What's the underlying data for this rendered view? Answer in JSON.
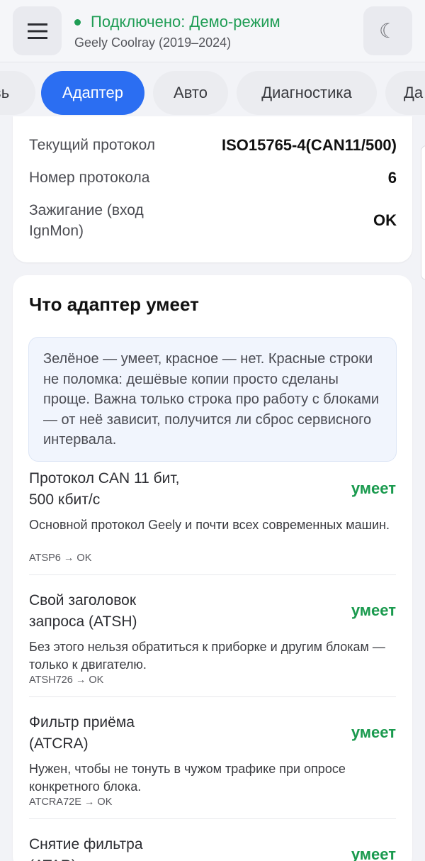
{
  "header": {
    "status": "Подключено: Демо-режим",
    "model": "Geely Coolray (2019–2024)",
    "menu_icon": "hamburger-icon",
    "theme_icon": "moon-icon",
    "theme_glyph": "☾"
  },
  "tabs": [
    "вь",
    "Адаптер",
    "Авто",
    "Диагностика",
    "Да"
  ],
  "protocol_info": {
    "rows": [
      {
        "label": "Текущий протокол",
        "value": "ISO15765-4(CAN11/500)"
      },
      {
        "label": "Номер протокола",
        "value": "6"
      },
      {
        "label": "Зажигание (вход IgnMon)",
        "value": "OK"
      }
    ]
  },
  "capabilities": {
    "title": "Что адаптер умеет",
    "note": "Зелёное — умеет, красное — нет. Красные строки не поломка: дешёвые копии просто сделаны проще. Важна только строка про работу с блоками — от неё зависит, получится ли сброс сервисного интервала.",
    "items": [
      {
        "name": "Протокол CAN 11 бит, 500 кбит/с",
        "status": "умеет",
        "description": "Основной протокол Geely и почти всех современных машин.",
        "command": "ATSP6 → OK"
      },
      {
        "name": "Свой заголовок запроса (ATSH)",
        "status": "умеет",
        "description": "Без этого нельзя обратиться к приборке и другим блокам — только к двигателю.",
        "command": "ATSH726 → OK"
      },
      {
        "name": "Фильтр приёма (ATCRA)",
        "status": "умеет",
        "description": "Нужен, чтобы не тонуть в чужом трафике при опросе конкретного блока.",
        "command": "ATCRA72E → OK"
      },
      {
        "name": "Снятие фильтра (ATAR)",
        "status": "умеет"
      }
    ]
  },
  "colors": {
    "accent": "#2b6ef2",
    "success": "#1a9a4e",
    "status_green": "#1f9d55"
  }
}
